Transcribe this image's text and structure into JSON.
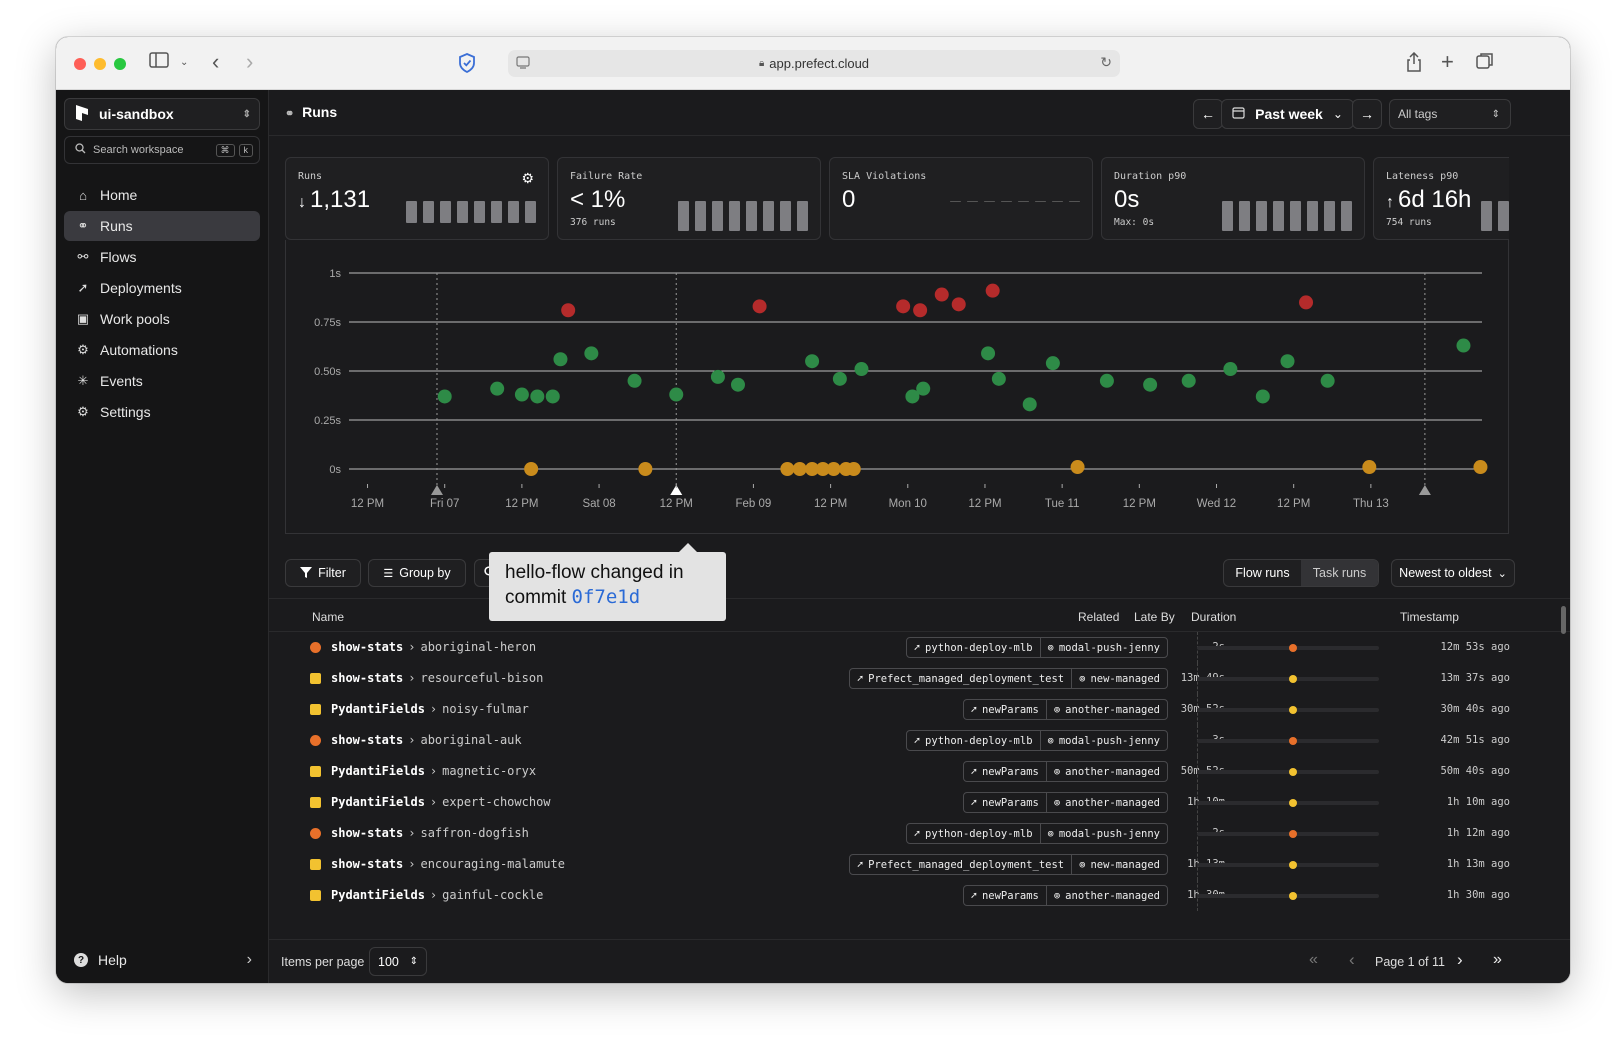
{
  "browser": {
    "url": "app.prefect.cloud"
  },
  "workspace": {
    "name": "ui-sandbox",
    "search_placeholder": "Search workspace",
    "kbd_cmd": "⌘",
    "kbd_k": "k"
  },
  "nav": [
    {
      "label": "Home",
      "icon": "home-icon"
    },
    {
      "label": "Runs",
      "icon": "runs-icon",
      "active": true
    },
    {
      "label": "Flows",
      "icon": "flows-icon"
    },
    {
      "label": "Deployments",
      "icon": "deployments-icon"
    },
    {
      "label": "Work pools",
      "icon": "work-pools-icon"
    },
    {
      "label": "Automations",
      "icon": "automations-icon"
    },
    {
      "label": "Events",
      "icon": "events-icon"
    },
    {
      "label": "Settings",
      "icon": "settings-icon"
    }
  ],
  "help": {
    "label": "Help"
  },
  "header": {
    "title": "Runs",
    "range_label": "Past week",
    "tags_label": "All tags"
  },
  "cards": [
    {
      "label": "Runs",
      "value": "1,131",
      "trend": "down",
      "sub": ""
    },
    {
      "label": "Failure Rate",
      "value": "< 1%",
      "sub": "376 runs"
    },
    {
      "label": "SLA Violations",
      "value": "0",
      "sub": ""
    },
    {
      "label": "Duration p90",
      "value": "0s",
      "sub": "Max: 0s"
    },
    {
      "label": "Lateness p90",
      "value": "6d 16h",
      "trend": "up",
      "sub": "754 runs"
    }
  ],
  "chart_data": {
    "type": "scatter",
    "y_labels": [
      "1s",
      "0.75s",
      "0.50s",
      "0.25s",
      "0s"
    ],
    "x_labels": [
      "12 PM",
      "Fri 07",
      "12 PM",
      "Sat 08",
      "12 PM",
      "Feb 09",
      "12 PM",
      "Mon 10",
      "12 PM",
      "Tue 11",
      "12 PM",
      "Wed 12",
      "12 PM",
      "Thu 13"
    ],
    "ylim": [
      0,
      1
    ],
    "colors": {
      "completed": "#2e8b47",
      "failed": "#b52b2b",
      "late": "#c98b1c"
    },
    "series": [
      {
        "name": "completed",
        "points": [
          [
            0.5,
            0.37
          ],
          [
            0.84,
            0.41
          ],
          [
            1.0,
            0.38
          ],
          [
            1.1,
            0.37
          ],
          [
            1.2,
            0.37
          ],
          [
            1.25,
            0.56
          ],
          [
            1.45,
            0.59
          ],
          [
            1.73,
            0.45
          ],
          [
            2.0,
            0.38
          ],
          [
            2.27,
            0.47
          ],
          [
            2.4,
            0.43
          ],
          [
            2.88,
            0.55
          ],
          [
            3.06,
            0.46
          ],
          [
            3.2,
            0.51
          ],
          [
            3.53,
            0.37
          ],
          [
            3.6,
            0.41
          ],
          [
            4.02,
            0.59
          ],
          [
            4.09,
            0.46
          ],
          [
            4.29,
            0.33
          ],
          [
            4.44,
            0.54
          ],
          [
            4.79,
            0.45
          ],
          [
            5.07,
            0.43
          ],
          [
            5.32,
            0.45
          ],
          [
            5.59,
            0.51
          ],
          [
            5.8,
            0.37
          ],
          [
            5.96,
            0.55
          ],
          [
            6.22,
            0.45
          ],
          [
            7.1,
            0.63
          ],
          [
            7.48,
            0.58
          ]
        ]
      },
      {
        "name": "failed",
        "points": [
          [
            1.3,
            0.81
          ],
          [
            2.54,
            0.83
          ],
          [
            3.47,
            0.83
          ],
          [
            3.58,
            0.81
          ],
          [
            3.72,
            0.89
          ],
          [
            3.83,
            0.84
          ],
          [
            4.05,
            0.91
          ],
          [
            6.08,
            0.85
          ]
        ]
      },
      {
        "name": "late",
        "points": [
          [
            1.06,
            0.0
          ],
          [
            1.8,
            0.0
          ],
          [
            2.72,
            0.0
          ],
          [
            2.8,
            0.0
          ],
          [
            2.88,
            0.0
          ],
          [
            2.95,
            0.0
          ],
          [
            3.02,
            0.0
          ],
          [
            3.1,
            0.0
          ],
          [
            3.15,
            0.0
          ],
          [
            4.6,
            0.01
          ],
          [
            6.49,
            0.01
          ],
          [
            7.21,
            0.01
          ]
        ]
      }
    ],
    "markers": [
      0.45,
      2.0,
      6.85
    ],
    "x_positions_days": [
      0.0,
      0.5,
      1.0,
      1.5,
      2.0,
      2.5,
      3.0,
      3.5,
      4.0,
      4.5,
      5.0,
      5.5,
      6.0,
      6.5
    ],
    "x_range_days": [
      -0.12,
      7.22
    ]
  },
  "tooltip": {
    "text": "hello-flow changed in commit",
    "hash": "0f7e1d"
  },
  "toolbar": {
    "filter": "Filter",
    "group_by": "Group by",
    "flow_runs": "Flow runs",
    "task_runs": "Task runs",
    "sort": "Newest to oldest"
  },
  "table": {
    "columns": {
      "name": "Name",
      "related": "Related",
      "late_by": "Late By",
      "duration": "Duration",
      "timestamp": "Timestamp"
    },
    "rows": [
      {
        "status": "failed",
        "flow": "show-stats",
        "run": "aboriginal-heron",
        "deployment": "python-deploy-mlb",
        "pool": "modal-push-jenny",
        "late_by": "2s",
        "timestamp": "12m 53s ago"
      },
      {
        "status": "late",
        "flow": "show-stats",
        "run": "resourceful-bison",
        "deployment": "Prefect_managed_deployment_test",
        "pool": "new-managed",
        "late_by": "13m 49s",
        "timestamp": "13m 37s ago"
      },
      {
        "status": "late",
        "flow": "PydantiFields",
        "run": "noisy-fulmar",
        "deployment": "newParams",
        "pool": "another-managed",
        "late_by": "30m 52s",
        "timestamp": "30m 40s ago"
      },
      {
        "status": "failed",
        "flow": "show-stats",
        "run": "aboriginal-auk",
        "deployment": "python-deploy-mlb",
        "pool": "modal-push-jenny",
        "late_by": "3s",
        "timestamp": "42m 51s ago"
      },
      {
        "status": "late",
        "flow": "PydantiFields",
        "run": "magnetic-oryx",
        "deployment": "newParams",
        "pool": "another-managed",
        "late_by": "50m 52s",
        "timestamp": "50m 40s ago"
      },
      {
        "status": "late",
        "flow": "PydantiFields",
        "run": "expert-chowchow",
        "deployment": "newParams",
        "pool": "another-managed",
        "late_by": "1h 10m",
        "timestamp": "1h 10m ago"
      },
      {
        "status": "failed",
        "flow": "show-stats",
        "run": "saffron-dogfish",
        "deployment": "python-deploy-mlb",
        "pool": "modal-push-jenny",
        "late_by": "2s",
        "timestamp": "1h 12m ago"
      },
      {
        "status": "late",
        "flow": "show-stats",
        "run": "encouraging-malamute",
        "deployment": "Prefect_managed_deployment_test",
        "pool": "new-managed",
        "late_by": "1h 13m",
        "timestamp": "1h 13m ago"
      },
      {
        "status": "late",
        "flow": "PydantiFields",
        "run": "gainful-cockle",
        "deployment": "newParams",
        "pool": "another-managed",
        "late_by": "1h 30m",
        "timestamp": "1h 30m ago"
      }
    ]
  },
  "footer": {
    "items_per_page_label": "Items per page",
    "items_per_page": "100",
    "page_label": "Page 1 of 11"
  },
  "status_colors": {
    "failed": "#e8702a",
    "late": "#f2c230"
  }
}
